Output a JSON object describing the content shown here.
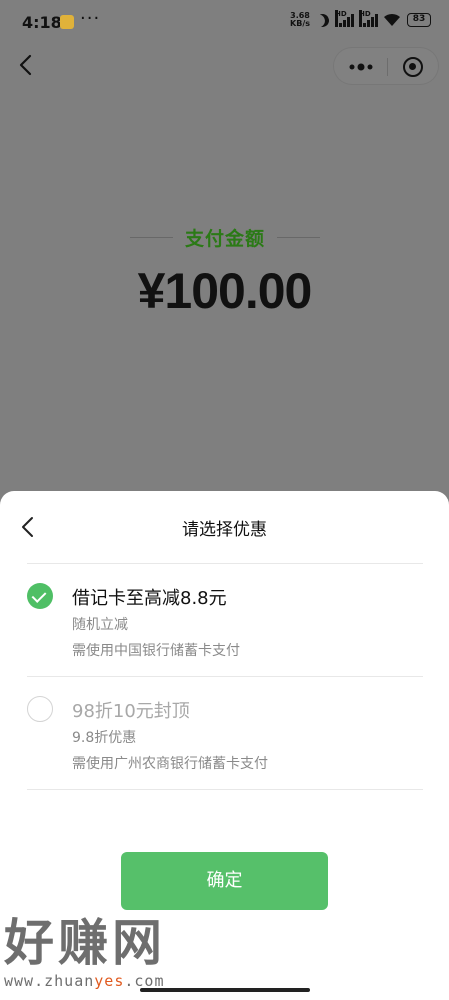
{
  "status_bar": {
    "time": "4:18",
    "more": "···",
    "net_speed_value": "3.68",
    "net_speed_unit": "KB/s",
    "hd_label": "HD",
    "battery": "83"
  },
  "header": {
    "back_icon": "chevron-left-icon",
    "more_icon": "more-dots-icon",
    "close_icon": "target-icon"
  },
  "payment": {
    "label": "支付金额",
    "amount": "¥100.00",
    "label_color": "#2b7a16"
  },
  "sheet": {
    "title": "请选择优惠",
    "options": [
      {
        "title": "借记卡至高减8.8元",
        "subtitle": "随机立减",
        "requirement": "需使用中国银行储蓄卡支付",
        "selected": true
      },
      {
        "title": "98折10元封顶",
        "subtitle": "9.8折优惠",
        "requirement": "需使用广州农商银行储蓄卡支付",
        "selected": false
      }
    ],
    "confirm_label": "确定",
    "accent_color": "#56c06a"
  },
  "watermark": {
    "text": "好赚网",
    "url_prefix": "www.zhuan",
    "url_highlight": "yes",
    "url_suffix": ".com"
  }
}
